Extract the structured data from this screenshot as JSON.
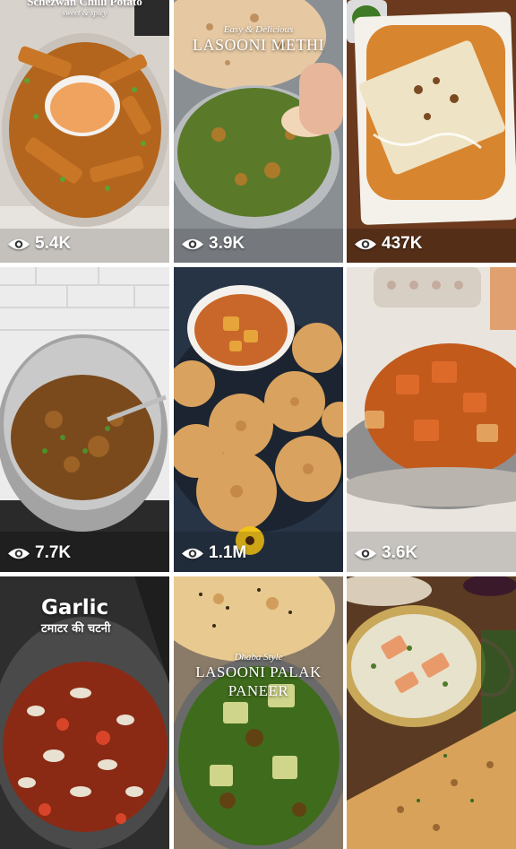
{
  "tiles": [
    {
      "id": "r1c1",
      "views": "5.4K",
      "title": "Schezwan Chilli Potato",
      "subtitle": "sweet & spicy"
    },
    {
      "id": "r1c2",
      "views": "3.9K",
      "tagline": "Easy & Delicious",
      "title": "LASOONI METHI"
    },
    {
      "id": "r1c3",
      "views": "437K"
    },
    {
      "id": "r2c1",
      "views": "7.7K"
    },
    {
      "id": "r2c2",
      "views": "1.1M"
    },
    {
      "id": "r2c3",
      "views": "3.6K"
    },
    {
      "id": "r3c1",
      "title": "Garlic",
      "subtitle": "टमाटर की चटनी"
    },
    {
      "id": "r3c2",
      "tagline": "Dhaba Style",
      "title_line1": "LASOONI PALAK",
      "title_line2": "PANEER"
    },
    {
      "id": "r3c3"
    }
  ],
  "icons": {
    "views": "eye-icon"
  },
  "colors": {
    "overlay_text": "#ffffff",
    "gap": "#ffffff"
  }
}
